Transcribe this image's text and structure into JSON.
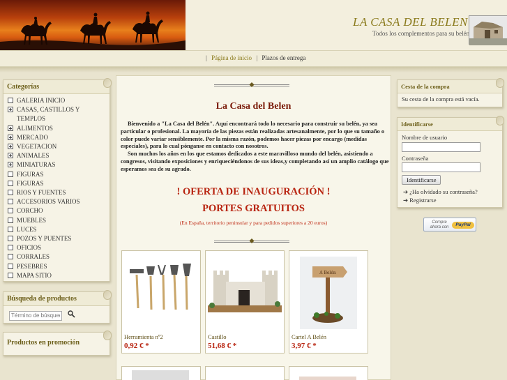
{
  "header": {
    "site_title": "LA CASA DEL BELEN",
    "tagline": "Todos los complementos para su belén"
  },
  "nav": {
    "items": [
      {
        "label": "Página de inicio"
      },
      {
        "label": "Plazos de entrega"
      }
    ]
  },
  "sidebar_left": {
    "categories_title": "Categorías",
    "categories": [
      {
        "label": "GALERIA INICIO",
        "expandable": false
      },
      {
        "label": "CASAS, CASTILLOS Y TEMPLOS",
        "expandable": true
      },
      {
        "label": "ALIMENTOS",
        "expandable": true
      },
      {
        "label": "MERCADO",
        "expandable": true
      },
      {
        "label": "VEGETACION",
        "expandable": true
      },
      {
        "label": "ANIMALES",
        "expandable": true
      },
      {
        "label": "MINIATURAS",
        "expandable": true
      },
      {
        "label": "FIGURAS",
        "expandable": false
      },
      {
        "label": "FIGURAS",
        "expandable": false
      },
      {
        "label": "RIOS Y FUENTES",
        "expandable": false
      },
      {
        "label": "ACCESORIOS VARIOS",
        "expandable": false
      },
      {
        "label": "CORCHO",
        "expandable": false
      },
      {
        "label": "MUEBLES",
        "expandable": false
      },
      {
        "label": "LUCES",
        "expandable": false
      },
      {
        "label": "POZOS Y PUENTES",
        "expandable": false
      },
      {
        "label": "OFICIOS",
        "expandable": false
      },
      {
        "label": "CORRALES",
        "expandable": false
      },
      {
        "label": "PESEBRES",
        "expandable": false
      },
      {
        "label": "MAPA SITIO",
        "expandable": false
      }
    ],
    "search_title": "Búsqueda de productos",
    "search_placeholder": "Término de búsqueda",
    "promo_title": "Productos en promoción"
  },
  "main": {
    "title": "La Casa del Belen",
    "intro": "Bienvenido a \"La Casa del Belén\". Aquí encontrará todo lo necesario para construir su belén, ya sea particular o profesional. La mayoría de las piezas están realizadas artesanalmente, por lo que su tamaño o color puede variar sensiblemente. Por la misma razón, podemos hacer piezas por encargo (medidas especiales), para lo cual pónganse en contacto con nosotros.",
    "intro2": "Son muchos los años en los que estamos dedicados a este maravilloso mundo del belén, asistiendo a congresos, visitando exposiciones y enriqueciéndonos de sus ideas,y completando así un amplio catálogo que esperamos sea de su agrado.",
    "offer_line1": "! OFERTA DE INAUGURACIÓN !",
    "offer_line2": "PORTES GRATUITOS",
    "offer_note": "(En España, territorio peninsular y para pedidos superiores a 20 euros)",
    "products": [
      {
        "name": "Herramienta nº2",
        "price": "0,92 € *"
      },
      {
        "name": "Castillo",
        "price": "51,68 € *"
      },
      {
        "name": "Cartel A Belén",
        "price": "3,97 € *"
      }
    ],
    "sign_text": "A Belén"
  },
  "sidebar_right": {
    "cart_title": "Cesta de la compra",
    "cart_empty": "Su cesta de la compra está vacía.",
    "login_title": "Identificarse",
    "username_label": "Nombre de usuario",
    "password_label": "Contraseña",
    "login_button": "Identificarse",
    "forgot_link": "¿Ha olvidado su contraseña?",
    "register_link": "Registrarse",
    "paypal_text": "Compre ahora con",
    "paypal_logo": "PayPal"
  }
}
